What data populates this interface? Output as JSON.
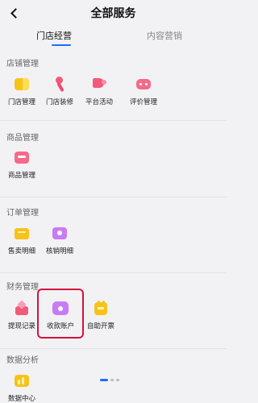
{
  "header": {
    "title": "全部服务"
  },
  "tabs": [
    {
      "label": "门店经营",
      "active": true
    },
    {
      "label": "内容营销",
      "active": false
    }
  ],
  "sections": {
    "store": {
      "title": "店铺管理",
      "items": [
        "门店管理",
        "门店装修",
        "平台活动",
        "评价管理"
      ]
    },
    "goods": {
      "title": "商品管理",
      "items": [
        "商品管理"
      ]
    },
    "orders": {
      "title": "订单管理",
      "items": [
        "售卖明细",
        "核销明细"
      ]
    },
    "finance": {
      "title": "财务管理",
      "items": [
        "提现记录",
        "收款账户",
        "自助开票"
      ]
    },
    "analytics": {
      "title": "数据分析",
      "items": [
        "数据中心"
      ]
    }
  },
  "icons": {
    "store_manage": "store-icon",
    "store_decor": "paintbrush-icon",
    "platform_activity": "megaphone-icon",
    "review_manage": "review-icon",
    "goods_manage": "goods-icon",
    "sales_detail": "sales-icon",
    "verify_detail": "verify-icon",
    "withdraw_record": "withdraw-icon",
    "payment_account": "heart-wallet-icon",
    "self_invoice": "invoice-icon",
    "data_center": "data-icon"
  },
  "colors": {
    "accent": "#1e6bff",
    "highlight_border": "#d3123f",
    "yellow": "#f7c21a",
    "pink": "#f25a7a",
    "purple": "#b56bf0"
  }
}
